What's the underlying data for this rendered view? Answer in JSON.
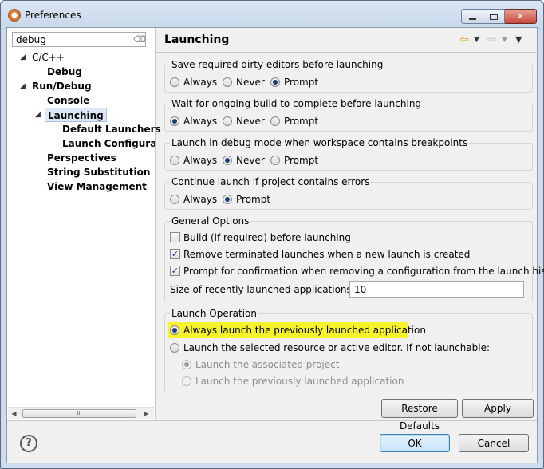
{
  "window": {
    "title": "Preferences",
    "minimize_glyph": "",
    "close_glyph": "✕"
  },
  "filter": {
    "value": "debug"
  },
  "tree": {
    "items": [
      {
        "label": "C/C++"
      },
      {
        "label": "Debug"
      },
      {
        "label": "Run/Debug"
      },
      {
        "label": "Console"
      },
      {
        "label": "Launching"
      },
      {
        "label": "Default Launchers"
      },
      {
        "label": "Launch Configurati"
      },
      {
        "label": "Perspectives"
      },
      {
        "label": "String Substitution"
      },
      {
        "label": "View Management"
      }
    ],
    "scroll_thumb_glyph": "III"
  },
  "page": {
    "title": "Launching",
    "groups": {
      "save_editors": {
        "label": "Save required dirty editors before launching",
        "options": [
          "Always",
          "Never",
          "Prompt"
        ]
      },
      "wait_build": {
        "label": "Wait for ongoing build to complete before launching",
        "options": [
          "Always",
          "Never",
          "Prompt"
        ]
      },
      "debug_mode": {
        "label": "Launch in debug mode when workspace contains breakpoints",
        "options": [
          "Always",
          "Never",
          "Prompt"
        ]
      },
      "continue_errors": {
        "label": "Continue launch if project contains errors",
        "options": [
          "Always",
          "Prompt"
        ]
      },
      "general": {
        "label": "General Options",
        "build_before": "Build (if required) before launching",
        "remove_terminated": "Remove terminated launches when a new launch is created",
        "prompt_confirm": "Prompt for confirmation when removing a configuration from the launch history",
        "size_label": "Size of recently launched applications list:",
        "size_value": "10"
      },
      "launch_operation": {
        "label": "Launch Operation",
        "always_previous": "Always launch the previously launched application",
        "launch_selected": "Launch the selected resource or active editor. If not launchable:",
        "launch_associated": "Launch the associated project",
        "launch_previous": "Launch the previously launched application"
      }
    },
    "buttons": {
      "restore_defaults": "Restore Defaults",
      "apply": "Apply"
    }
  },
  "dialog": {
    "help_glyph": "?",
    "ok": "OK",
    "cancel": "Cancel"
  },
  "colors": {
    "highlight": "#f6f32b",
    "window_frame": "#cfdcec",
    "selection": "#dde8f6"
  }
}
